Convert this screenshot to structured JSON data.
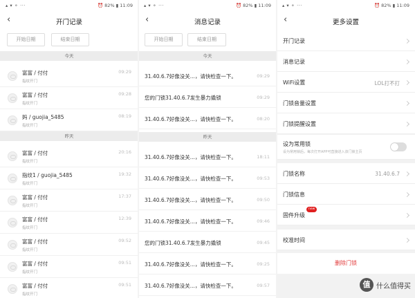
{
  "status_bars": [
    {
      "left": "▴ ▾ ⚬ ···",
      "right": "⏰ 82% ▮ 11:09"
    },
    {
      "left": "▴ ▾ ⚬ ···",
      "right": "⏰ 82% ▮ 11:09"
    },
    {
      "left": "▴ ▾ ⚬ ···",
      "right": "⏰ 82% ▮ 11:09"
    }
  ],
  "panel1": {
    "title": "开门记录",
    "back": "‹",
    "start_date": "开始日期",
    "end_date": "结束日期",
    "sections": [
      {
        "label": "今天",
        "items": [
          {
            "name": "富富 / 付付",
            "sub": "指纹开门",
            "time": "09:29"
          },
          {
            "name": "富富 / 付付",
            "sub": "指纹开门",
            "time": "09:28"
          },
          {
            "name": "妈 / guojia_5485",
            "sub": "指纹开门",
            "time": "08:19"
          }
        ]
      },
      {
        "label": "昨天",
        "items": [
          {
            "name": "富富 / 付付",
            "sub": "指纹开门",
            "time": "20:16"
          },
          {
            "name": "指纹1 / guojia_5485",
            "sub": "指纹开门",
            "time": "19:32"
          },
          {
            "name": "富富 / 付付",
            "sub": "指纹开门",
            "time": "17:37"
          },
          {
            "name": "富富 / 付付",
            "sub": "指纹开门",
            "time": "12:39"
          },
          {
            "name": "富富 / 付付",
            "sub": "指纹开门",
            "time": "09:52"
          },
          {
            "name": "富富 / 付付",
            "sub": "指纹开门",
            "time": "09:51"
          },
          {
            "name": "富富 / 付付",
            "sub": "指纹开门",
            "time": "09:51"
          }
        ]
      }
    ]
  },
  "panel2": {
    "title": "消息记录",
    "back": "‹",
    "start_date": "开始日期",
    "end_date": "结束日期",
    "sections": [
      {
        "label": "今天",
        "items": [
          {
            "text": "31.40.6.7好像没关...，请快检查一下。",
            "time": "09:29"
          },
          {
            "text": "您的门锁31.40.6.7发生暴力撬锁",
            "time": "09:29"
          },
          {
            "text": "31.40.6.7好像没关...，请快检查一下。",
            "time": "08:20"
          }
        ]
      },
      {
        "label": "昨天",
        "items": [
          {
            "text": "31.40.6.7好像没关...，请快检查一下。",
            "time": "18:11"
          },
          {
            "text": "31.40.6.7好像没关...，请快检查一下。",
            "time": "09:53"
          },
          {
            "text": "31.40.6.7好像没关...，请快检查一下。",
            "time": "09:50"
          },
          {
            "text": "31.40.6.7好像没关...，请快检查一下。",
            "time": "09:46"
          },
          {
            "text": "您的门锁31.40.6.7发生暴力撬锁",
            "time": "09:45"
          },
          {
            "text": "31.40.6.7好像没关...，请快检查一下。",
            "time": "09:25"
          },
          {
            "text": "31.40.6.7好像没关...，请快检查一下。",
            "time": "09:57"
          }
        ]
      }
    ]
  },
  "panel3": {
    "title": "更多设置",
    "back": "‹",
    "group1": [
      {
        "label": "开门记录"
      },
      {
        "label": "消息记录"
      },
      {
        "label": "WiFi设置",
        "value": "LOL打不打"
      },
      {
        "label": "门锁音量设置"
      },
      {
        "label": "门锁提醒设置"
      }
    ],
    "common_lock": {
      "label": "设为常用锁",
      "sub": "设为常用锁后，每次打开APP可直接进入该门锁主页",
      "enabled": false
    },
    "group2": [
      {
        "label": "门锁名称",
        "value": "31.40.6.7"
      },
      {
        "label": "门锁信息"
      },
      {
        "label": "固件升级",
        "badge": "new"
      }
    ],
    "group3": [
      {
        "label": "校准时间"
      }
    ],
    "delete_label": "删除门锁",
    "colors": {
      "danger": "#e23b3b",
      "badge": "#e02020",
      "toggle_off": "#dddddd"
    }
  },
  "watermark": {
    "logo": "值",
    "text": "什么值得买"
  }
}
